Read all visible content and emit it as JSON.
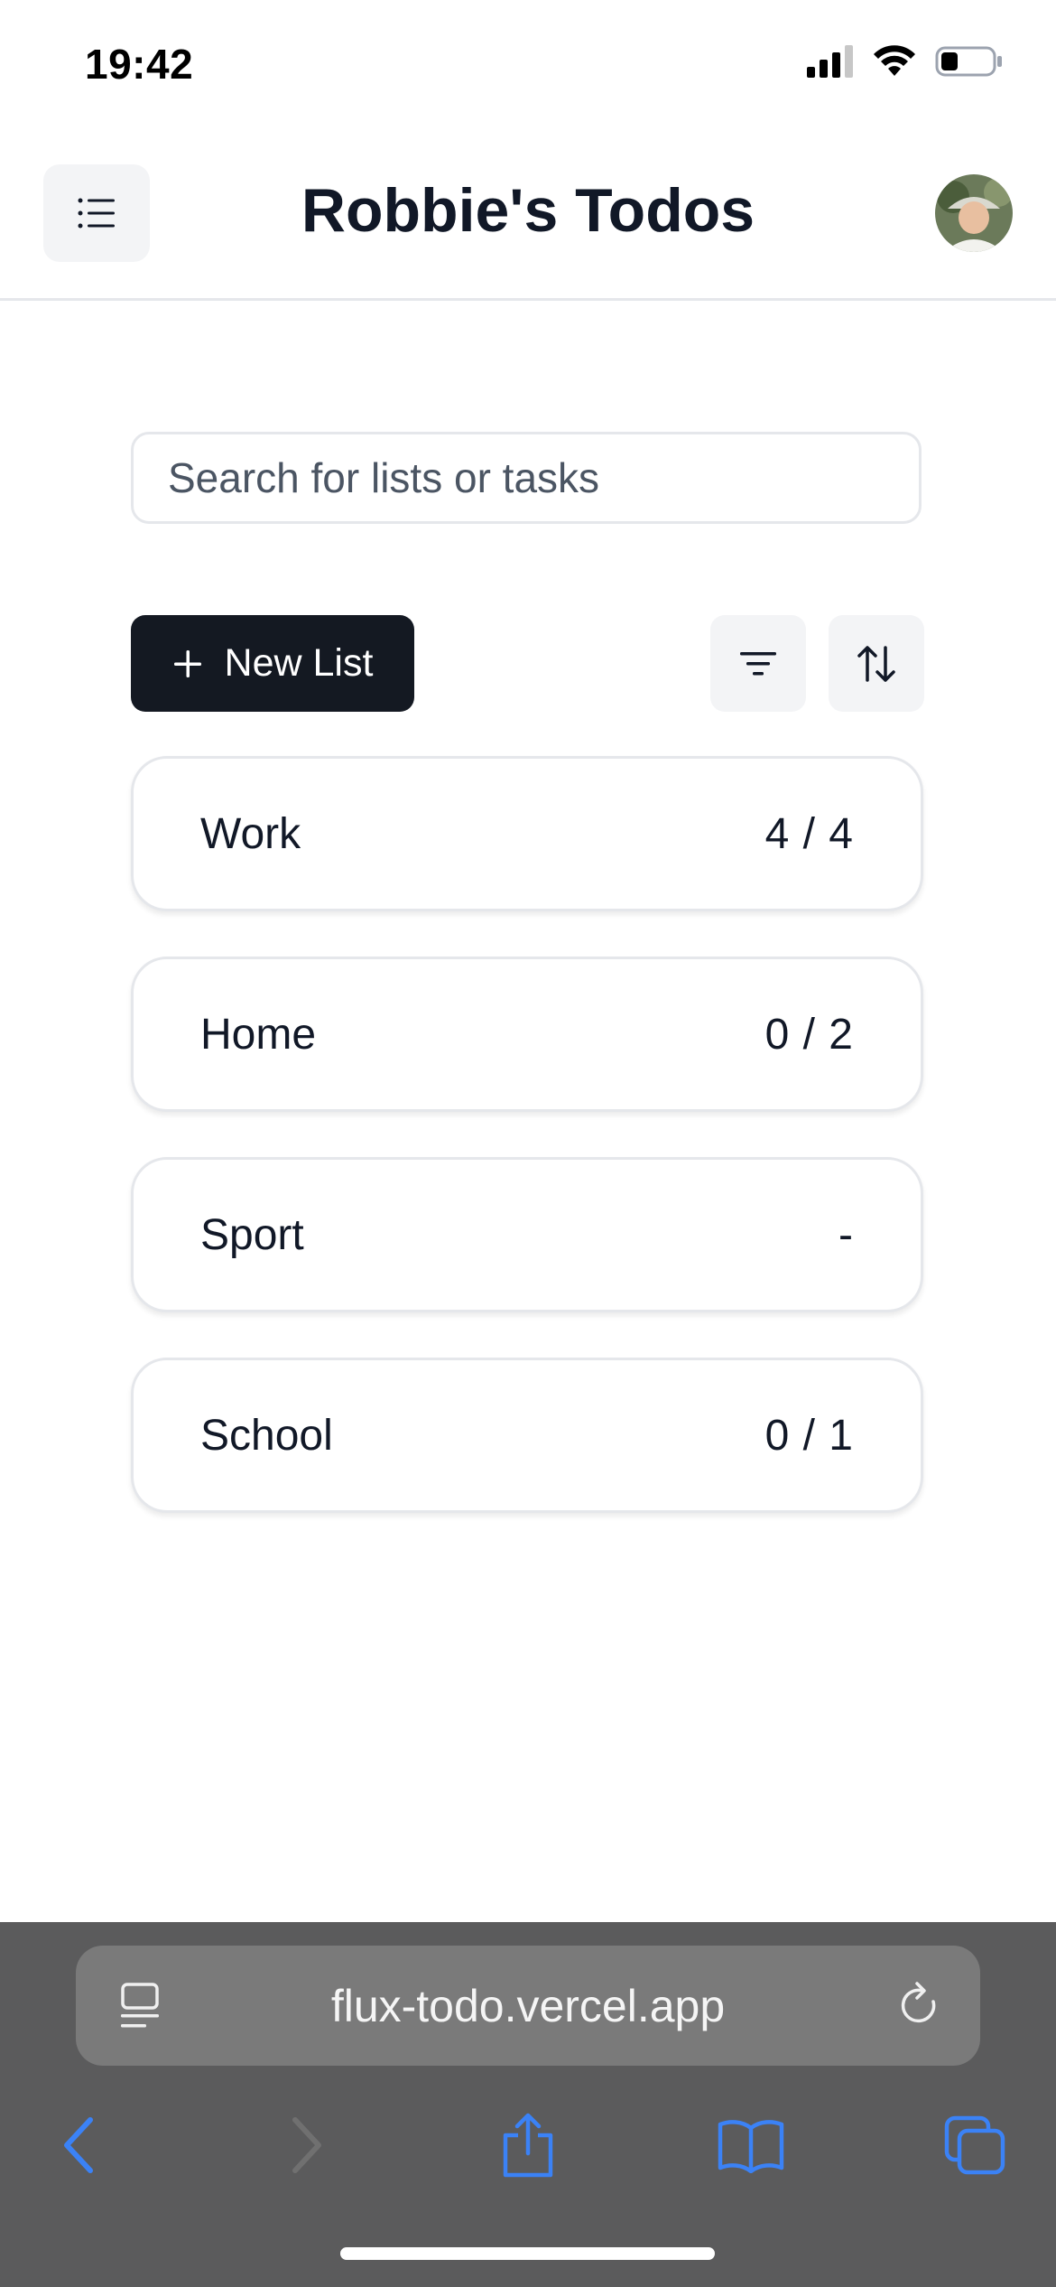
{
  "status_bar": {
    "time": "19:42"
  },
  "header": {
    "title": "Robbie's Todos"
  },
  "search": {
    "placeholder": "Search for lists or tasks"
  },
  "actions": {
    "new_list_label": "New List"
  },
  "lists": [
    {
      "name": "Work",
      "count": "4 / 4"
    },
    {
      "name": "Home",
      "count": "0 / 2"
    },
    {
      "name": "Sport",
      "count": "-"
    },
    {
      "name": "School",
      "count": "0 / 1"
    }
  ],
  "browser": {
    "url": "flux-todo.vercel.app"
  },
  "colors": {
    "primary_button": "#141922",
    "safari_toolbar": "#5b5b5c",
    "safari_blue": "#3b82f6"
  },
  "icons": {
    "menu": "list-icon",
    "filter": "filter-icon",
    "sort": "sort-arrows-icon",
    "add": "plus-icon"
  }
}
